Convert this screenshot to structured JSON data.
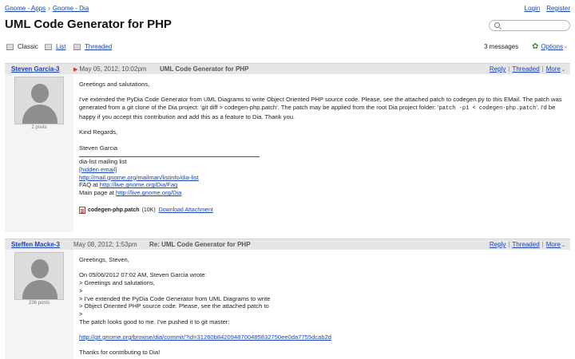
{
  "breadcrumb": {
    "items": [
      "Gnome - Apps",
      "Gnome - Dia"
    ],
    "separator": "›"
  },
  "auth": {
    "login": "Login",
    "register": "Register"
  },
  "page": {
    "title": "UML Code Generator for PHP"
  },
  "search": {
    "placeholder": ""
  },
  "views": {
    "classic": "Classic",
    "list": "List",
    "threaded": "Threaded"
  },
  "messages": {
    "count": "3 messages",
    "options": "Options"
  },
  "actions": {
    "reply": "Reply",
    "threaded": "Threaded",
    "more": "More"
  },
  "posts": [
    {
      "author": "Steven Garcia-3",
      "date": "May 05, 2012; 10:02pm",
      "subject": "UML Code Generator for PHP",
      "post_count": "2 posts",
      "body": {
        "greeting": "Greetings and salutations,",
        "para1": "I've extended the PyDia Code Generator from UML Diagrams to write Object Oriented PHP source code. Please, see the attached patch to codegen.py to this EMail. The patch was generated from a git clone of the Dia project: 'git diff > codegen-php.patch'. The patch may be applied from the root Dia project folder:",
        "para1_code_pre": "'",
        "para1_code": "patch -p1 < codegen-php.patch",
        "para1_code_post": "'. I'd be happy if you accept this contribution and add this as a feature to Dia. Thank you.",
        "closing": "Kind Regards,",
        "signature": "Steven Garcia",
        "list_name": "dia-list mailing list",
        "hidden_email": "[hidden email]",
        "mailman_url": "http://mail.gnome.org/mailman/listinfo/dia-list",
        "faq_label": "FAQ at",
        "faq_url": "http://live.gnome.org/Dia/Faq",
        "main_label": "Main page at",
        "main_url": "http://live.gnome.org/Dia",
        "attachment": {
          "name": "codegen-php.patch",
          "size": "(10K)",
          "download": "Download Attachment"
        }
      }
    },
    {
      "author": "Steffen Macke-3",
      "date": "May 08, 2012; 1:53pm",
      "subject": "Re: UML Code Generator for PHP",
      "post_count": "236 posts",
      "body": {
        "greeting": "Greetings, Steven,",
        "quote_intro": "On 05/06/2012 07:02 AM, Steven Garcia wrote:",
        "quote_lines": [
          "> Greetings and salutations,",
          ">",
          "> I've extended the PyDia Code Generator from UML Diagrams to write",
          "> Object Oriented PHP source code. Please, see the attached patch to",
          ">"
        ],
        "reply": "The patch looks good to me. I've pushed it to git master:",
        "commit_url": "http://git.gnome.org/browse/dia/commit/?id=31260b8420948700485832750ee0da7755dcab2d",
        "thanks": "Thanks for contributing to Dia!"
      }
    }
  ]
}
